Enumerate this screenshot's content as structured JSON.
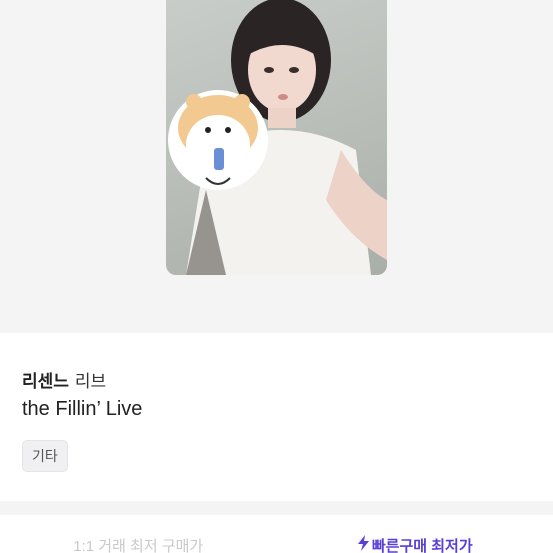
{
  "product": {
    "artist": "리센느",
    "member": "리브",
    "album": "the Fillin’ Live",
    "tag": "기타"
  },
  "tabs": [
    {
      "label": "1:1 거래 최저 구매가",
      "active": false
    },
    {
      "label": "빠른구매 최저가",
      "active": true,
      "icon": "lightning-icon"
    }
  ],
  "colors": {
    "accent": "#5a3fd6",
    "inactive_tab": "#c9c9cc",
    "hero_bg": "#f4f4f5"
  }
}
